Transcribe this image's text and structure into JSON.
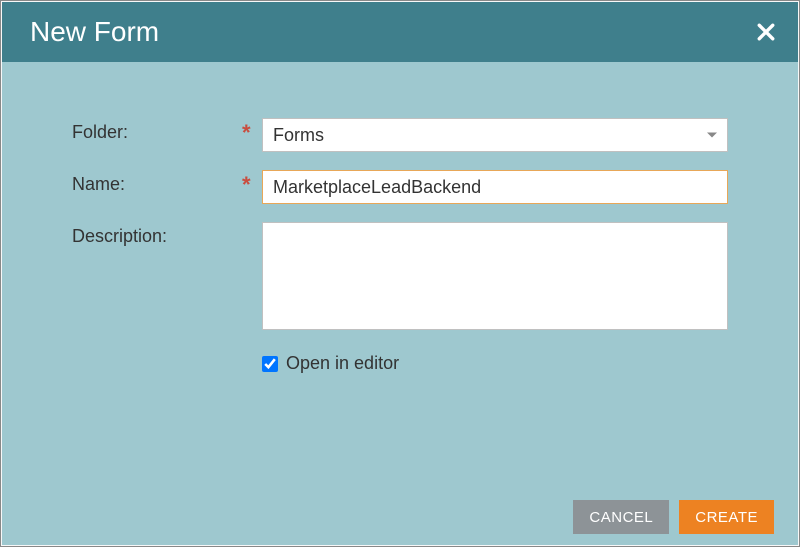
{
  "dialog": {
    "title": "New Form"
  },
  "form": {
    "folder_label": "Folder:",
    "folder_value": "Forms",
    "name_label": "Name:",
    "name_value": "MarketplaceLeadBackend",
    "description_label": "Description:",
    "description_value": "",
    "open_in_editor_label": "Open in editor",
    "open_in_editor_checked": true,
    "required_mark": "*"
  },
  "buttons": {
    "cancel": "CANCEL",
    "create": "CREATE"
  }
}
